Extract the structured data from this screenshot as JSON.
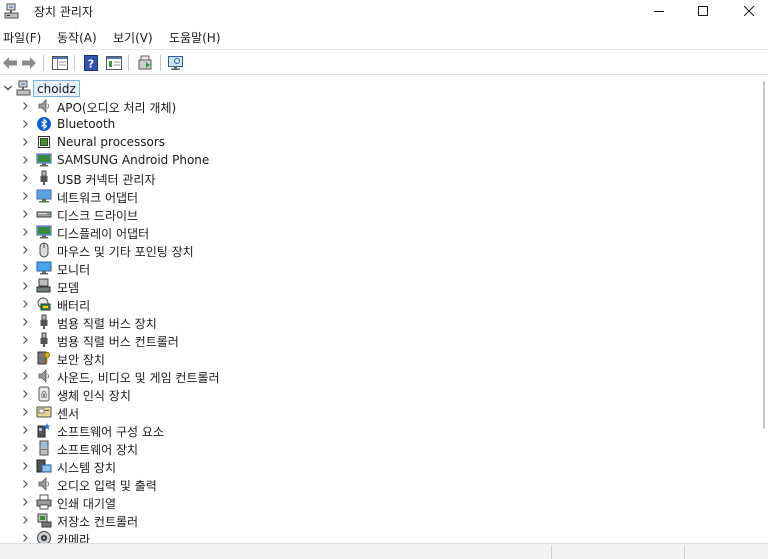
{
  "window": {
    "title": "장치 관리자"
  },
  "menu": [
    {
      "label": "파일(F)"
    },
    {
      "label": "동작(A)"
    },
    {
      "label": "보기(V)"
    },
    {
      "label": "도움말(H)"
    }
  ],
  "toolbar": {
    "buttons": [
      "back-icon",
      "forward-icon",
      "show-hide-console-tree-icon",
      "help-icon",
      "properties-icon",
      "update-driver-icon",
      "scan-hardware-icon"
    ]
  },
  "tree": {
    "root": {
      "label": "choidz",
      "icon": "computer-icon"
    },
    "items": [
      {
        "label": "APO(오디오 처리 개체)",
        "icon": "speaker-icon"
      },
      {
        "label": "Bluetooth",
        "icon": "bluetooth-icon"
      },
      {
        "label": "Neural processors",
        "icon": "chip-icon"
      },
      {
        "label": "SAMSUNG Android Phone",
        "icon": "phone-icon"
      },
      {
        "label": "USB 커넥터 관리자",
        "icon": "usb-icon"
      },
      {
        "label": "네트워크 어댑터",
        "icon": "network-icon"
      },
      {
        "label": "디스크 드라이브",
        "icon": "disk-icon"
      },
      {
        "label": "디스플레이 어댑터",
        "icon": "display-adapter-icon"
      },
      {
        "label": "마우스 및 기타 포인팅 장치",
        "icon": "mouse-icon"
      },
      {
        "label": "모니터",
        "icon": "monitor-icon"
      },
      {
        "label": "모뎀",
        "icon": "modem-icon"
      },
      {
        "label": "배터리",
        "icon": "battery-icon"
      },
      {
        "label": "범용 직렬 버스 장치",
        "icon": "usb-icon"
      },
      {
        "label": "범용 직렬 버스 컨트롤러",
        "icon": "usb-icon"
      },
      {
        "label": "보안 장치",
        "icon": "security-key-icon"
      },
      {
        "label": "사운드, 비디오 및 게임 컨트롤러",
        "icon": "speaker-icon"
      },
      {
        "label": "생체 인식 장치",
        "icon": "fingerprint-icon"
      },
      {
        "label": "센서",
        "icon": "sensor-icon"
      },
      {
        "label": "소프트웨어 구성 요소",
        "icon": "software-component-icon"
      },
      {
        "label": "소프트웨어 장치",
        "icon": "software-device-icon"
      },
      {
        "label": "시스템 장치",
        "icon": "system-device-icon"
      },
      {
        "label": "오디오 입력 및 출력",
        "icon": "speaker-icon"
      },
      {
        "label": "인쇄 대기열",
        "icon": "printer-icon"
      },
      {
        "label": "저장소 컨트롤러",
        "icon": "storage-controller-icon"
      },
      {
        "label": "카메라",
        "icon": "camera-icon"
      }
    ]
  },
  "colors": {
    "selection_bg": "#e6f0fa",
    "selection_border": "#7fb1e0",
    "bluetooth": "#0a5fd8"
  }
}
